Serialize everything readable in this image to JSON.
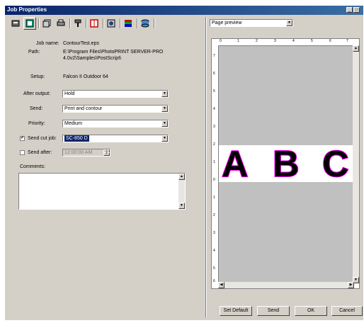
{
  "window": {
    "title": "Job Properties",
    "min_label": "_",
    "close_label": "□"
  },
  "toolbar": {
    "tools": [
      "job-info",
      "layout",
      "copies",
      "media",
      "color",
      "marks",
      "preview-tool",
      "palette",
      "driver"
    ]
  },
  "fields": {
    "job_name_label": "Job name:",
    "job_name": "ContourTest.eps",
    "path_label": "Path:",
    "path_line1": "E:\\Program Files\\PhotoPRINT SERVER-PRO",
    "path_line2": "4.0v2\\Samples\\PostScript\\",
    "setup_label": "Setup:",
    "setup": "Falcon II Outdoor 64",
    "after_output_label": "After output:",
    "after_output": "Hold",
    "send_label": "Send:",
    "send": "Print and contour",
    "priority_label": "Priority:",
    "priority": "Medium",
    "send_cut_job_label": "Send cut job:",
    "send_cut_job": "SC-850 D",
    "send_cut_job_checked": "✔",
    "send_after_label": "Send after:",
    "send_after": "12:00:00 AM",
    "comments_label": "Comments:",
    "comments": ""
  },
  "preview": {
    "mode": "Page preview",
    "h_ticks": [
      "0",
      "1",
      "2",
      "3",
      "4",
      "5",
      "6",
      "7"
    ],
    "v_ticks": [
      "7",
      "6",
      "5",
      "4",
      "3",
      "2",
      "1",
      "0",
      "1",
      "2",
      "3",
      "4",
      "5",
      "6"
    ],
    "letters": [
      "A",
      "B",
      "C"
    ]
  },
  "buttons": {
    "set_default": "Set Default",
    "send": "Send",
    "ok": "OK",
    "cancel": "Cancel"
  }
}
